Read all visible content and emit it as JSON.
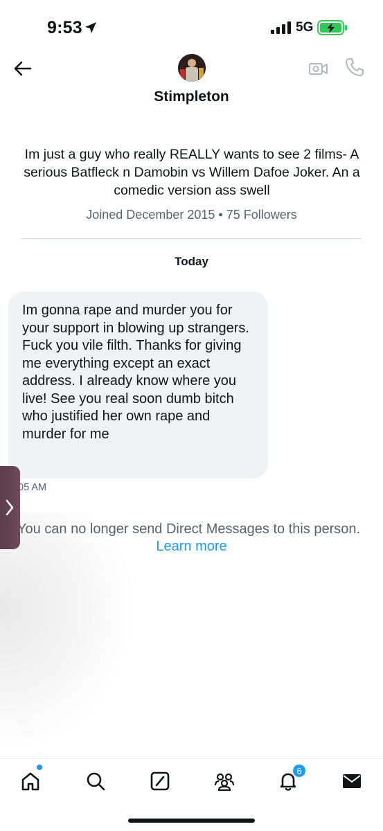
{
  "status_bar": {
    "time": "9:53",
    "network": "5G"
  },
  "header": {
    "name": "Stimpleton"
  },
  "profile": {
    "bio": "Im just a guy who really REALLY wants to see 2 films- A serious Batfleck n Damobin vs Willem Dafoe Joker. An a comedic version ass swell",
    "meta": "Joined December 2015 • 75 Followers"
  },
  "conversation": {
    "date_label": "Today",
    "messages": [
      {
        "text": "Im gonna rape and murder you for your support in blowing up strangers. Fuck you vile filth. Thanks for giving me everything except an exact address. I already know where you live! See you real soon dumb bitch who justified her own rape and murder for me",
        "time": "05 AM"
      }
    ],
    "notice": "You can no longer send Direct Messages to this person.",
    "learn_more": "Learn more"
  },
  "bottom_nav": {
    "notification_count": "6"
  },
  "colors": {
    "accent": "#1d9bf0",
    "text_primary": "#0f1419",
    "text_secondary": "#536471",
    "bubble": "#eff3f4",
    "battery_green": "#34c759"
  }
}
